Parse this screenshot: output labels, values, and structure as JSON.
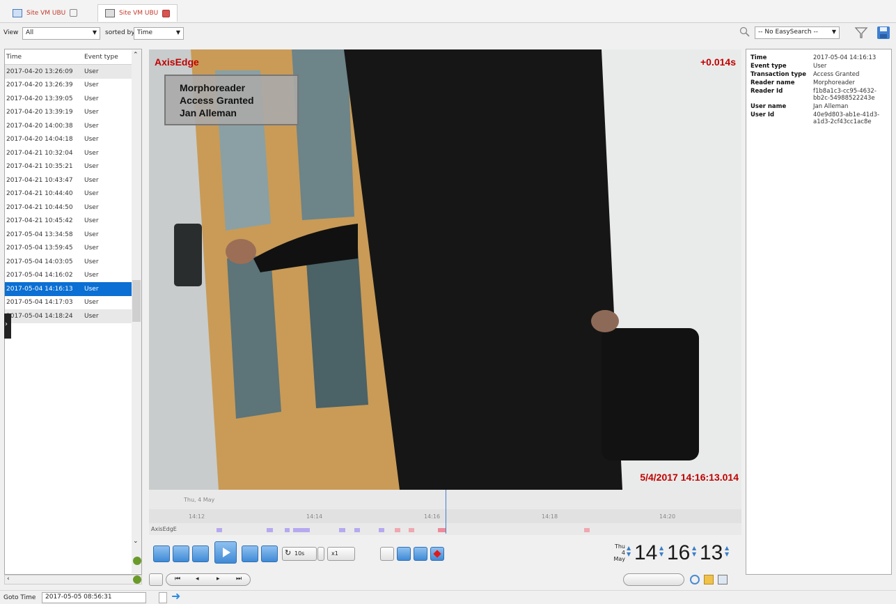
{
  "tabs": [
    {
      "label": "Site VM UBU"
    },
    {
      "label": "Site VM UBU"
    }
  ],
  "toolbar": {
    "view_label": "View",
    "view_value": "All",
    "sorted_label": "sorted by",
    "sorted_value": "Time",
    "easysearch_value": "-- No EasySearch --"
  },
  "list": {
    "col_time": "Time",
    "col_type": "Event type",
    "rows": [
      {
        "time": "2017-04-20 13:26:09",
        "type": "User"
      },
      {
        "time": "2017-04-20 13:26:39",
        "type": "User"
      },
      {
        "time": "2017-04-20 13:39:05",
        "type": "User"
      },
      {
        "time": "2017-04-20 13:39:19",
        "type": "User"
      },
      {
        "time": "2017-04-20 14:00:38",
        "type": "User"
      },
      {
        "time": "2017-04-20 14:04:18",
        "type": "User"
      },
      {
        "time": "2017-04-21 10:32:04",
        "type": "User"
      },
      {
        "time": "2017-04-21 10:35:21",
        "type": "User"
      },
      {
        "time": "2017-04-21 10:43:47",
        "type": "User"
      },
      {
        "time": "2017-04-21 10:44:40",
        "type": "User"
      },
      {
        "time": "2017-04-21 10:44:50",
        "type": "User"
      },
      {
        "time": "2017-04-21 10:45:42",
        "type": "User"
      },
      {
        "time": "2017-05-04 13:34:58",
        "type": "User"
      },
      {
        "time": "2017-05-04 13:59:45",
        "type": "User"
      },
      {
        "time": "2017-05-04 14:03:05",
        "type": "User"
      },
      {
        "time": "2017-05-04 14:16:02",
        "type": "User"
      },
      {
        "time": "2017-05-04 14:16:13",
        "type": "User"
      },
      {
        "time": "2017-05-04 14:17:03",
        "type": "User"
      },
      {
        "time": "2017-05-04 14:18:24",
        "type": "User"
      }
    ]
  },
  "video": {
    "camera_name": "AxisEdge",
    "offset": "+0.014s",
    "overlay_line1": "Morphoreader",
    "overlay_line2": "Access Granted",
    "overlay_line3": "Jan Alleman",
    "timestamp": "5/4/2017 14:16:13.014"
  },
  "info": [
    {
      "k": "Time",
      "v": "2017-05-04 14:16:13"
    },
    {
      "k": "Event type",
      "v": "User"
    },
    {
      "k": "Transaction type",
      "v": "Access Granted"
    },
    {
      "k": "Reader name",
      "v": "Morphoreader"
    },
    {
      "k": "Reader Id",
      "v": "f1b8a1c3-cc95-4632-bb2c-54988522243e"
    },
    {
      "k": "User name",
      "v": "Jan Alleman"
    },
    {
      "k": "User Id",
      "v": "40e9d803-ab1e-41d3-a1d3-2cf43cc1ac8e"
    }
  ],
  "timeline": {
    "day": "Thu, 4 May",
    "ticks": [
      "14:12",
      "14:14",
      "14:16",
      "14:18",
      "14:20"
    ],
    "track_label": "AxisEdgE"
  },
  "controls": {
    "skip": "10s",
    "speed": "x1",
    "clock_day": "Thu",
    "clock_date": "4 May",
    "hh": "14",
    "mm": "16",
    "ss": "13"
  },
  "goto": {
    "label": "Goto Time",
    "value": "2017-05-05 08:56:31"
  },
  "colors": {
    "selected_row": "#0b6fd3",
    "overlay_red": "#c00000",
    "accent_blue": "#3f8ad6"
  }
}
